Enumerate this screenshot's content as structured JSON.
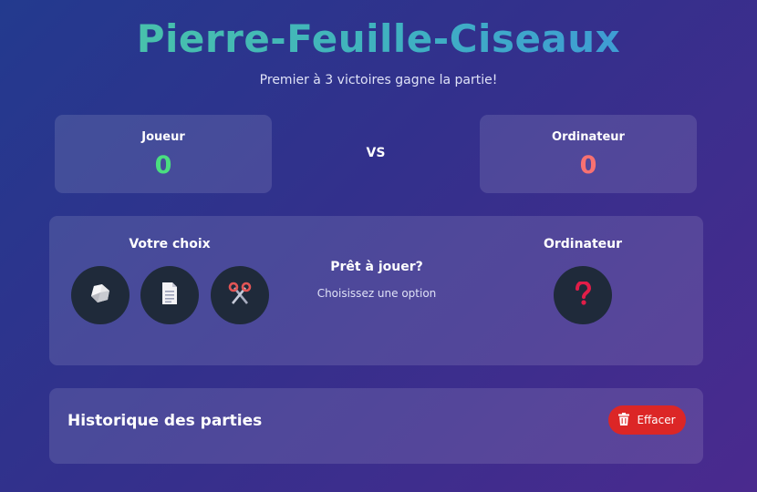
{
  "header": {
    "title": "Pierre-Feuille-Ciseaux",
    "subtitle": "Premier à 3 victoires gagne la partie!"
  },
  "scoreboard": {
    "player": {
      "label": "Joueur",
      "score": "0"
    },
    "vs": "VS",
    "computer": {
      "label": "Ordinateur",
      "score": "0"
    }
  },
  "game": {
    "player_label": "Votre choix",
    "computer_label": "Ordinateur",
    "status_title": "Prêt à jouer?",
    "status_sub": "Choisissez une option",
    "choices": [
      {
        "icon": "rock-icon"
      },
      {
        "icon": "paper-icon"
      },
      {
        "icon": "scissors-icon"
      }
    ],
    "computer_choice_icon": "question-mark-icon"
  },
  "history": {
    "title": "Historique des parties",
    "clear_label": "Effacer",
    "clear_icon": "trash-icon"
  },
  "colors": {
    "player_score": "#4ade80",
    "computer_score": "#f87171",
    "clear_button": "#dc2626",
    "choice_button": "#1f2a3a"
  }
}
